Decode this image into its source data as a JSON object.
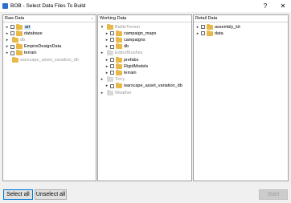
{
  "window": {
    "title": "BOB - Select Data Files To Build",
    "help_glyph": "?",
    "close_glyph": "✕"
  },
  "panels": {
    "raw": {
      "header": "Raw Data",
      "items": [
        {
          "label": "art",
          "indent": 0,
          "expander": "▸",
          "checkbox": true,
          "folder": "yellow",
          "grey": false,
          "selected": true
        },
        {
          "label": "database",
          "indent": 0,
          "expander": "▸",
          "checkbox": true,
          "folder": "yellow",
          "grey": false,
          "selected": false
        },
        {
          "label": "db",
          "indent": 0,
          "expander": "▸",
          "checkbox": false,
          "folder": "yellow",
          "grey": true,
          "selected": false
        },
        {
          "label": "EmpireDesignData",
          "indent": 0,
          "expander": "▸",
          "checkbox": true,
          "folder": "yellow",
          "grey": false,
          "selected": false
        },
        {
          "label": "terrain",
          "indent": 0,
          "expander": "▸",
          "checkbox": true,
          "folder": "yellow",
          "grey": false,
          "selected": false
        },
        {
          "label": "warscape_asset_variation_db",
          "indent": 0,
          "expander": "",
          "checkbox": false,
          "folder": "yellow",
          "grey": true,
          "selected": false
        }
      ]
    },
    "working": {
      "header": "Working Data",
      "items": [
        {
          "label": "BattleTerrain",
          "indent": 0,
          "expander": "▾",
          "checkbox": false,
          "folder": "yellow",
          "grey": true,
          "selected": false
        },
        {
          "label": "campaign_maps",
          "indent": 1,
          "expander": "▸",
          "checkbox": true,
          "folder": "yellow",
          "grey": false,
          "selected": false
        },
        {
          "label": "campaigns",
          "indent": 1,
          "expander": "▸",
          "checkbox": true,
          "folder": "yellow",
          "grey": false,
          "selected": false
        },
        {
          "label": "db",
          "indent": 1,
          "expander": "▸",
          "checkbox": true,
          "folder": "yellow",
          "grey": false,
          "selected": false
        },
        {
          "label": "EditorBrushes",
          "indent": 0,
          "expander": "▸",
          "checkbox": false,
          "folder": "grey",
          "grey": true,
          "selected": false
        },
        {
          "label": "prefabs",
          "indent": 1,
          "expander": "▸",
          "checkbox": true,
          "folder": "yellow",
          "grey": false,
          "selected": false
        },
        {
          "label": "RigidModels",
          "indent": 1,
          "expander": "▸",
          "checkbox": true,
          "folder": "yellow",
          "grey": false,
          "selected": false
        },
        {
          "label": "terrain",
          "indent": 1,
          "expander": "▸",
          "checkbox": true,
          "folder": "yellow",
          "grey": false,
          "selected": false
        },
        {
          "label": "Terry",
          "indent": 0,
          "expander": "▸",
          "checkbox": false,
          "folder": "grey",
          "grey": true,
          "selected": false
        },
        {
          "label": "warscape_asset_variation_db",
          "indent": 1,
          "expander": "▸",
          "checkbox": true,
          "folder": "yellow",
          "grey": false,
          "selected": false
        },
        {
          "label": "Weather",
          "indent": 0,
          "expander": "▸",
          "checkbox": false,
          "folder": "grey",
          "grey": true,
          "selected": false
        }
      ]
    },
    "retail": {
      "header": "Retail Data",
      "items": [
        {
          "label": "assembly_kit",
          "indent": 0,
          "expander": "▸",
          "checkbox": true,
          "folder": "yellow",
          "grey": false,
          "selected": false
        },
        {
          "label": "data",
          "indent": 0,
          "expander": "▸",
          "checkbox": true,
          "folder": "yellow",
          "grey": false,
          "selected": false
        }
      ]
    }
  },
  "buttons": {
    "select_all": "Select all",
    "unselect_all": "Unselect all",
    "start": "Start"
  }
}
